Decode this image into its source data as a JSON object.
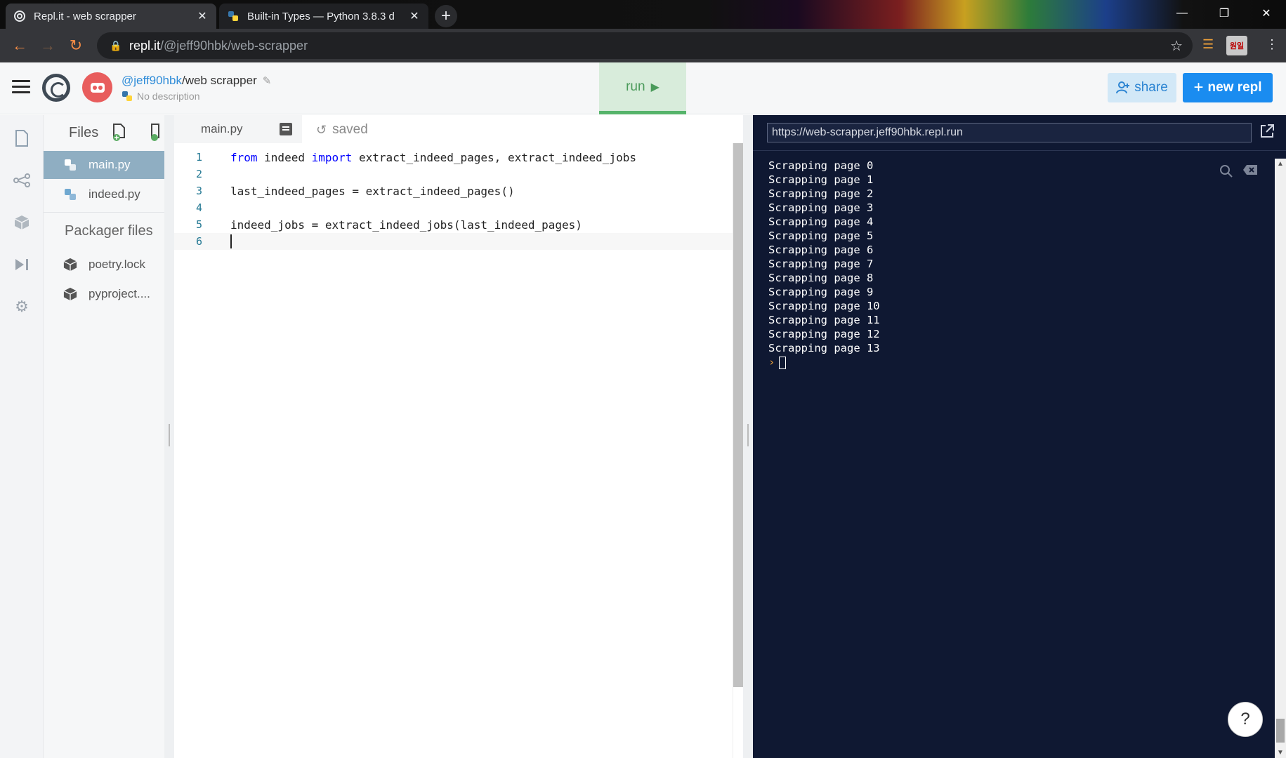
{
  "browser": {
    "tabs": [
      {
        "title": "Repl.it - web scrapper",
        "active": true
      },
      {
        "title": "Built-in Types — Python 3.8.3 d",
        "active": false
      }
    ],
    "close_glyph": "✕",
    "new_tab_glyph": "+",
    "url_host": "repl.it",
    "url_path": "/@jeff90hbk/web-scrapper",
    "profile_badge": "원일"
  },
  "header": {
    "owner": "@jeff90hbk",
    "separator": "/",
    "repl_name": "web scrapper",
    "description": "No description",
    "run_label": "run",
    "share_label": "share",
    "new_repl_label": "new repl"
  },
  "files": {
    "heading": "Files",
    "items": [
      {
        "name": "main.py",
        "active": true
      },
      {
        "name": "indeed.py",
        "active": false
      }
    ],
    "packager_heading": "Packager files",
    "packager_items": [
      {
        "name": "poetry.lock"
      },
      {
        "name": "pyproject...."
      }
    ]
  },
  "editor": {
    "tab_label": "main.py",
    "status": "saved",
    "lines": [
      {
        "num": "1",
        "kw1": "from",
        "a": " indeed ",
        "kw2": "import",
        "b": " extract_indeed_pages, extract_indeed_jobs"
      },
      {
        "num": "2",
        "text": ""
      },
      {
        "num": "3",
        "text": "last_indeed_pages = extract_indeed_pages()"
      },
      {
        "num": "4",
        "text": ""
      },
      {
        "num": "5",
        "text": "indeed_jobs = extract_indeed_jobs(last_indeed_pages)"
      },
      {
        "num": "6",
        "text": ""
      }
    ]
  },
  "console": {
    "url": "https://web-scrapper.jeff90hbk.repl.run",
    "output": [
      "Scrapping page 0",
      "Scrapping page 1",
      "Scrapping page 2",
      "Scrapping page 3",
      "Scrapping page 4",
      "Scrapping page 5",
      "Scrapping page 6",
      "Scrapping page 7",
      "Scrapping page 8",
      "Scrapping page 9",
      "Scrapping page 10",
      "Scrapping page 11",
      "Scrapping page 12",
      "Scrapping page 13"
    ],
    "prompt": "›",
    "help_label": "?"
  },
  "colors": {
    "run_bg": "#d8ecdb",
    "accent_blue": "#1a8cf0",
    "console_bg": "#0f1832"
  }
}
